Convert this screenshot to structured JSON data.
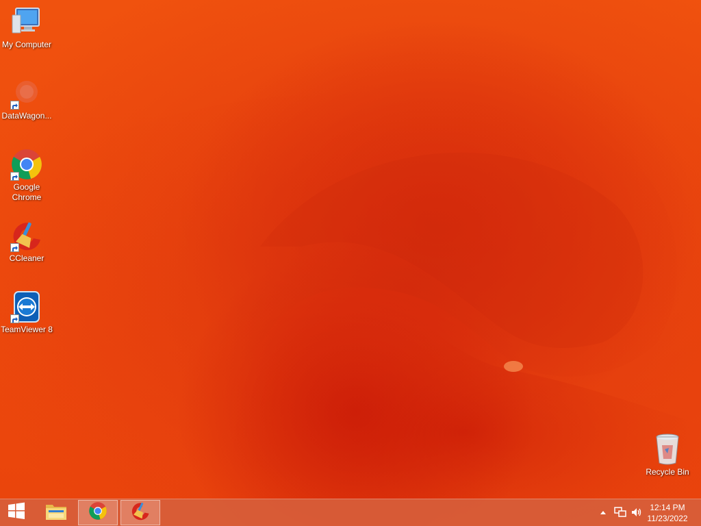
{
  "desktop": {
    "icons": [
      {
        "label": "My Computer",
        "icon": "computer-icon"
      },
      {
        "label": "DataWagon...",
        "icon": "datawagon-icon"
      },
      {
        "label": "Google Chrome",
        "icon": "chrome-icon"
      },
      {
        "label": "CCleaner",
        "icon": "ccleaner-icon"
      },
      {
        "label": "TeamViewer 8",
        "icon": "teamviewer-icon"
      },
      {
        "label": "Recycle Bin",
        "icon": "recycle-bin-icon"
      }
    ]
  },
  "taskbar": {
    "start": {
      "icon": "windows-start-icon"
    },
    "pinned": [
      {
        "name": "File Explorer",
        "icon": "folder-icon",
        "active": false
      },
      {
        "name": "Google Chrome",
        "icon": "chrome-icon",
        "active": true
      },
      {
        "name": "CCleaner",
        "icon": "ccleaner-icon",
        "active": true
      }
    ],
    "tray": {
      "icons": [
        "show-hidden-icons-arrow",
        "network-icon",
        "volume-icon"
      ],
      "time": "12:14 PM",
      "date": "11/23/2022"
    }
  },
  "colors": {
    "wallpaper": "#ee4c0d",
    "taskbar": "#d6603c"
  }
}
